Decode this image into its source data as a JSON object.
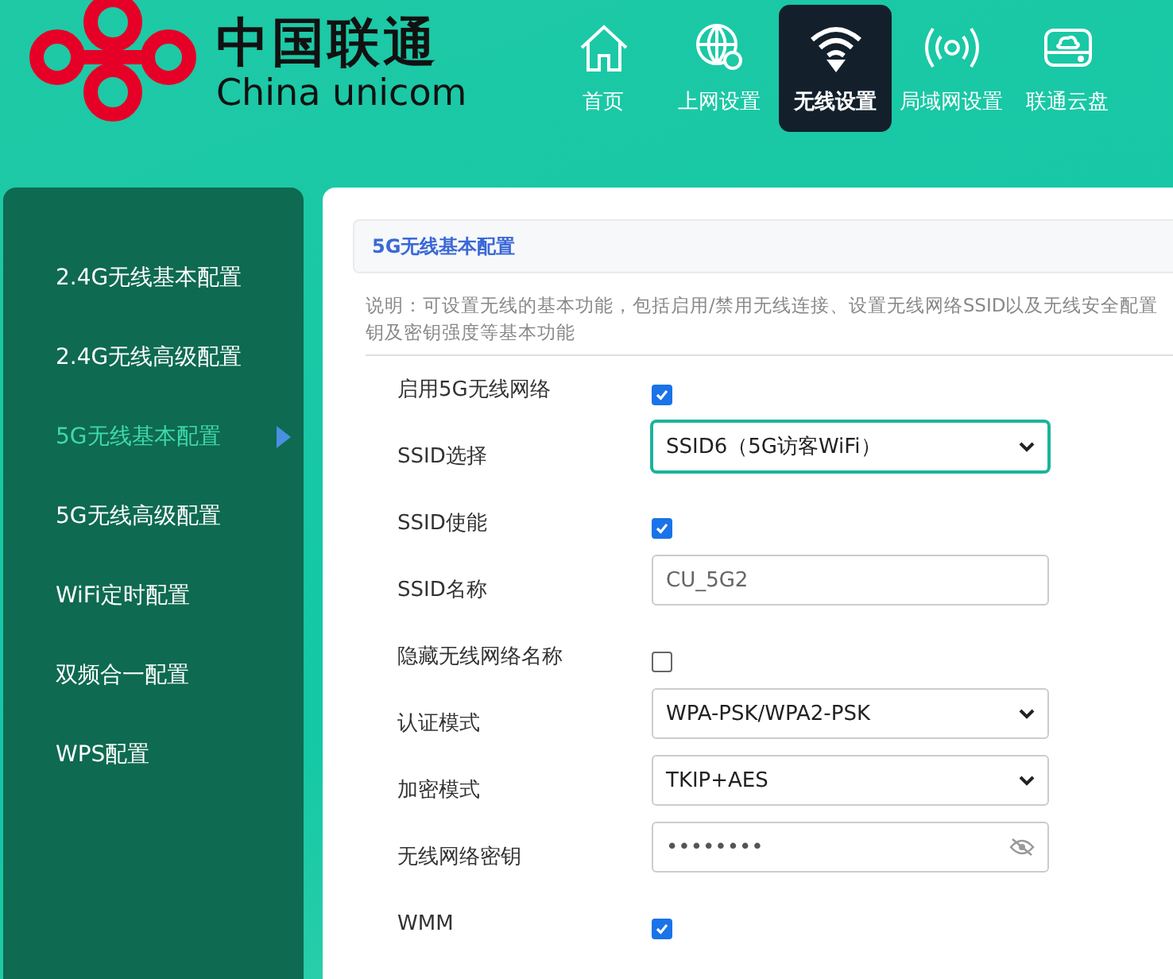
{
  "logo": {
    "title": "中国联通",
    "subtitle": "China unicom"
  },
  "nav": [
    {
      "label": "首页",
      "kind": "home",
      "selected": false
    },
    {
      "label": "上网设置",
      "kind": "globe",
      "selected": false
    },
    {
      "label": "无线设置",
      "kind": "wifi",
      "selected": true
    },
    {
      "label": "局域网设置",
      "kind": "signal",
      "selected": false
    },
    {
      "label": "联通云盘",
      "kind": "cloud",
      "selected": false
    }
  ],
  "sidebar": {
    "items": [
      {
        "label": "2.4G无线基本配置",
        "selected": false
      },
      {
        "label": "2.4G无线高级配置",
        "selected": false
      },
      {
        "label": "5G无线基本配置",
        "selected": true
      },
      {
        "label": "5G无线高级配置",
        "selected": false
      },
      {
        "label": "WiFi定时配置",
        "selected": false
      },
      {
        "label": "双频合一配置",
        "selected": false
      },
      {
        "label": "WPS配置",
        "selected": false
      }
    ]
  },
  "panel": {
    "title": "5G无线基本配置",
    "description_lines": [
      "说明：可设置无线的基本功能，包括启用/禁用无线连接、设置无线网络SSID以及无线安全配置",
      "钥及密钥强度等基本功能"
    ],
    "fields": [
      {
        "label": "启用5G无线网络",
        "kind": "checkbox",
        "checked": true
      },
      {
        "label": "SSID选择",
        "kind": "select",
        "value": "SSID6（5G访客WiFi）",
        "focused": true
      },
      {
        "label": "SSID使能",
        "kind": "checkbox",
        "checked": true
      },
      {
        "label": "SSID名称",
        "kind": "text",
        "value": "CU_5G2"
      },
      {
        "label": "隐藏无线网络名称",
        "kind": "checkbox",
        "checked": false
      },
      {
        "label": "认证模式",
        "kind": "select",
        "value": "WPA-PSK/WPA2-PSK",
        "focused": false
      },
      {
        "label": "加密模式",
        "kind": "select",
        "value": "TKIP+AES",
        "focused": false
      },
      {
        "label": "无线网络密钥",
        "kind": "password",
        "value": "••••••••"
      },
      {
        "label": "WMM",
        "kind": "checkbox",
        "checked": true
      }
    ]
  }
}
